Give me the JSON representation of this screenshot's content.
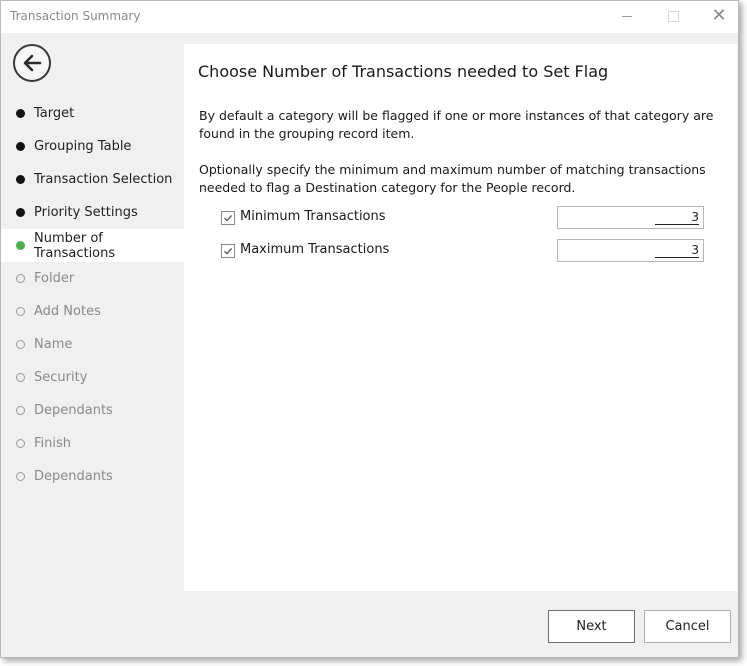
{
  "window": {
    "title": "Transaction Summary"
  },
  "sidebar": {
    "back_icon": "back-arrow-icon",
    "items": [
      {
        "label": "Target",
        "state": "done"
      },
      {
        "label": "Grouping Table",
        "state": "done"
      },
      {
        "label": "Transaction Selection",
        "state": "done"
      },
      {
        "label": "Priority Settings",
        "state": "done"
      },
      {
        "label": "Number of Transactions",
        "state": "current"
      },
      {
        "label": "Folder",
        "state": "todo"
      },
      {
        "label": "Add Notes",
        "state": "todo"
      },
      {
        "label": "Name",
        "state": "todo"
      },
      {
        "label": "Security",
        "state": "todo"
      },
      {
        "label": "Dependants",
        "state": "todo"
      },
      {
        "label": "Finish",
        "state": "todo"
      },
      {
        "label": "Dependants",
        "state": "todo"
      }
    ]
  },
  "main": {
    "heading": "Choose Number of Transactions needed to Set Flag",
    "paragraph1": "By default a category will be flagged if one or more instances of that category are found in the grouping record item.",
    "paragraph2": "Optionally specify the minimum and maximum number of matching transactions needed to flag a Destination category for the People record.",
    "options": [
      {
        "label": "Minimum Transactions",
        "checked": true,
        "value": "3"
      },
      {
        "label": "Maximum Transactions",
        "checked": true,
        "value": "3"
      }
    ]
  },
  "footer": {
    "next_label": "Next",
    "cancel_label": "Cancel"
  },
  "colors": {
    "current_step": "#4caf50",
    "completed_step": "#111111",
    "pending_step": "#9a9a9a"
  }
}
